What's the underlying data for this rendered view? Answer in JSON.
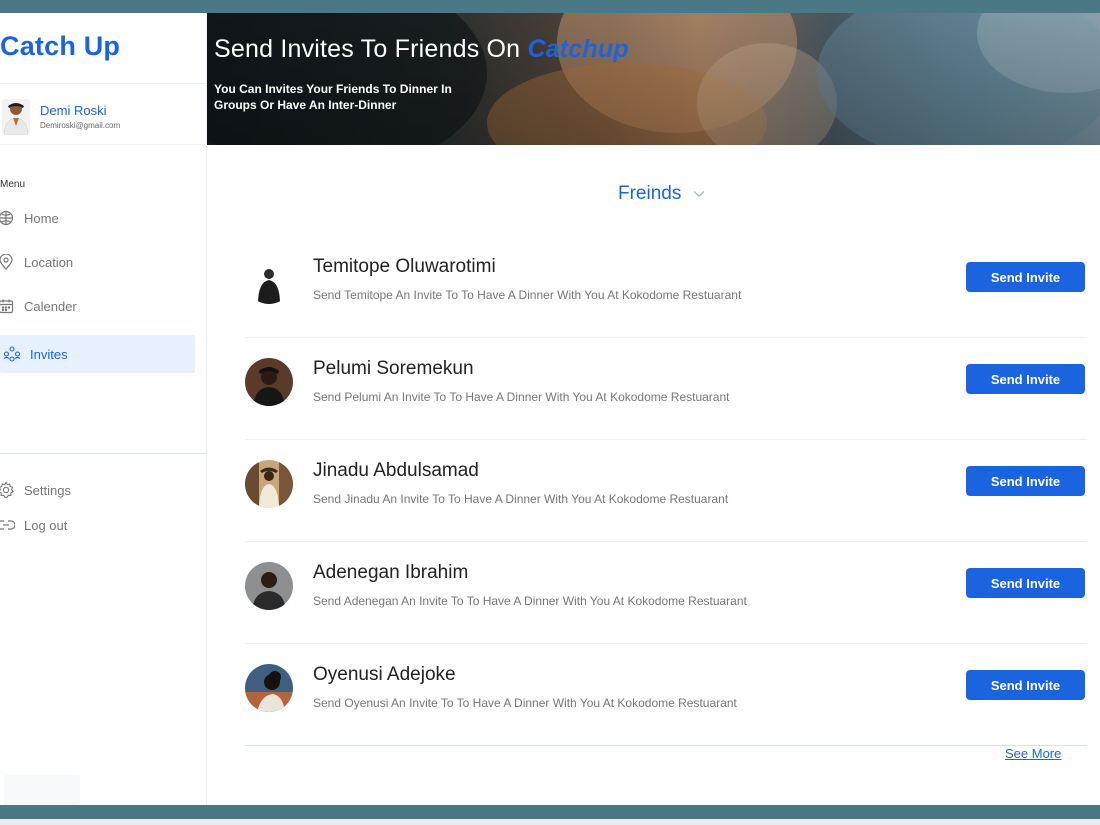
{
  "app": {
    "brand": "Catch Up"
  },
  "user": {
    "name": "Demi Roski",
    "email": "Demiroski@gmail.com"
  },
  "sidebar": {
    "menu_title": "Menu",
    "items": [
      {
        "label": "Home",
        "icon": "globe-icon"
      },
      {
        "label": "Location",
        "icon": "map-pin-icon"
      },
      {
        "label": "Calender",
        "icon": "calendar-icon"
      },
      {
        "label": "Invites",
        "icon": "people-icon",
        "active": true
      }
    ],
    "bottom_items": [
      {
        "label": "Settings",
        "icon": "gear-icon"
      },
      {
        "label": "Log out",
        "icon": "logout-icon"
      }
    ]
  },
  "hero": {
    "title_prefix": "Send Invites To Friends On ",
    "title_brand": "Catchup",
    "subtitle": "You Can Invites Your Friends To Dinner In Groups Or Have An Inter-Dinner"
  },
  "filter": {
    "label": "Freinds"
  },
  "friends": [
    {
      "name": "Temitope Oluwarotimi",
      "desc": "Send Temitope An Invite To To Have A Dinner With You  At Kokodome Restuarant",
      "button": "Send Invite"
    },
    {
      "name": "Pelumi Soremekun",
      "desc": "Send Pelumi An Invite To To Have A Dinner With You  At Kokodome Restuarant",
      "button": "Send Invite"
    },
    {
      "name": "Jinadu Abdulsamad",
      "desc": "Send Jinadu An Invite To To Have A Dinner With You  At Kokodome Restuarant",
      "button": "Send Invite"
    },
    {
      "name": "Adenegan Ibrahim",
      "desc": "Send Adenegan  An Invite To To Have A Dinner With You  At Kokodome Restuarant",
      "button": "Send Invite"
    },
    {
      "name": "Oyenusi Adejoke",
      "desc": "Send Oyenusi An Invite To To Have A Dinner With You  At Kokodome Restuarant",
      "button": "Send Invite"
    }
  ],
  "see_more": "See More",
  "colors": {
    "brand": "#1b64e0",
    "accent_strip": "#4a7885",
    "active_nav_bg": "#e8f1ff"
  }
}
